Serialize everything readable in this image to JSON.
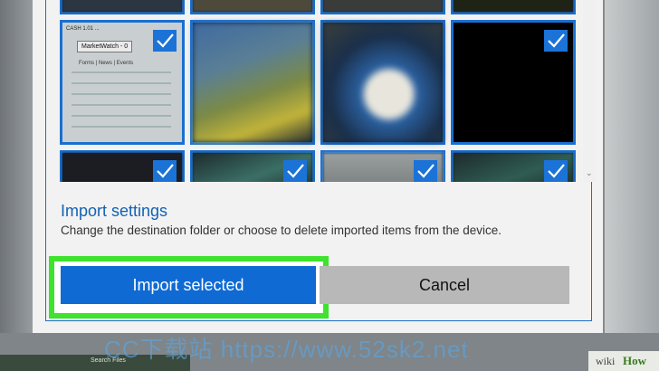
{
  "thumbnails": [
    {
      "name": "thumb-top-1",
      "checked": false
    },
    {
      "name": "thumb-top-2",
      "checked": false
    },
    {
      "name": "thumb-top-3",
      "checked": false
    },
    {
      "name": "thumb-top-4",
      "checked": false
    },
    {
      "name": "thumb-marketwatch",
      "checked": true
    },
    {
      "name": "thumb-blurred-photo-1",
      "checked": false
    },
    {
      "name": "thumb-blurred-photo-2",
      "checked": false
    },
    {
      "name": "thumb-black",
      "checked": true
    },
    {
      "name": "thumb-bottom-1",
      "checked": true
    },
    {
      "name": "thumb-bottom-2",
      "checked": true
    },
    {
      "name": "thumb-bottom-3",
      "checked": true
    },
    {
      "name": "thumb-bottom-4",
      "checked": true
    }
  ],
  "thumb_text": {
    "marketwatch_header": "CASH 1.01 ...",
    "marketwatch_tab": "MarketWatch - 0",
    "marketwatch_menu": "Forms | News | Events"
  },
  "settings": {
    "title": "Import settings",
    "description": "Change the destination folder or choose to delete imported items from the device."
  },
  "buttons": {
    "import": "Import selected",
    "cancel": "Cancel"
  },
  "taskbar": {
    "label": "Search Files"
  },
  "watermark": "CC下载站  https://www.52sk2.net",
  "branding": {
    "prefix": "wiki",
    "suffix": "How"
  },
  "colors": {
    "accent": "#0f6ad4",
    "highlight": "#3de32c",
    "link": "#1262b3"
  }
}
